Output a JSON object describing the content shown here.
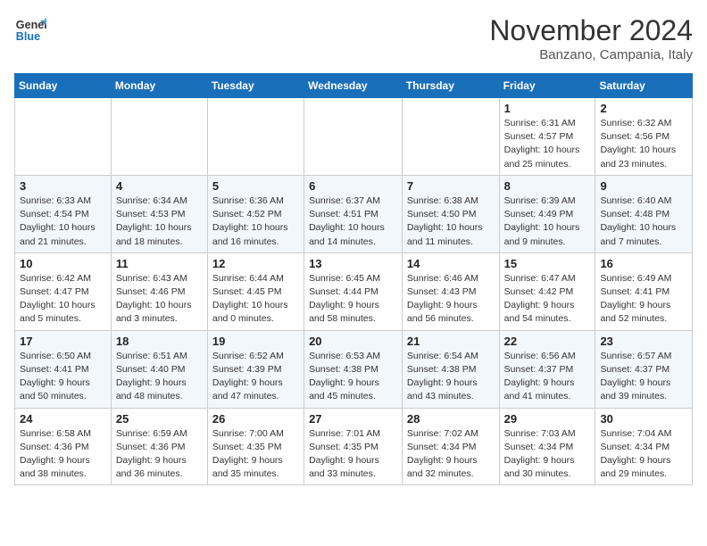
{
  "logo": {
    "line1": "General",
    "line2": "Blue"
  },
  "title": "November 2024",
  "location": "Banzano, Campania, Italy",
  "weekdays": [
    "Sunday",
    "Monday",
    "Tuesday",
    "Wednesday",
    "Thursday",
    "Friday",
    "Saturday"
  ],
  "weeks": [
    [
      {
        "day": "",
        "info": ""
      },
      {
        "day": "",
        "info": ""
      },
      {
        "day": "",
        "info": ""
      },
      {
        "day": "",
        "info": ""
      },
      {
        "day": "",
        "info": ""
      },
      {
        "day": "1",
        "info": "Sunrise: 6:31 AM\nSunset: 4:57 PM\nDaylight: 10 hours and 25 minutes."
      },
      {
        "day": "2",
        "info": "Sunrise: 6:32 AM\nSunset: 4:56 PM\nDaylight: 10 hours and 23 minutes."
      }
    ],
    [
      {
        "day": "3",
        "info": "Sunrise: 6:33 AM\nSunset: 4:54 PM\nDaylight: 10 hours and 21 minutes."
      },
      {
        "day": "4",
        "info": "Sunrise: 6:34 AM\nSunset: 4:53 PM\nDaylight: 10 hours and 18 minutes."
      },
      {
        "day": "5",
        "info": "Sunrise: 6:36 AM\nSunset: 4:52 PM\nDaylight: 10 hours and 16 minutes."
      },
      {
        "day": "6",
        "info": "Sunrise: 6:37 AM\nSunset: 4:51 PM\nDaylight: 10 hours and 14 minutes."
      },
      {
        "day": "7",
        "info": "Sunrise: 6:38 AM\nSunset: 4:50 PM\nDaylight: 10 hours and 11 minutes."
      },
      {
        "day": "8",
        "info": "Sunrise: 6:39 AM\nSunset: 4:49 PM\nDaylight: 10 hours and 9 minutes."
      },
      {
        "day": "9",
        "info": "Sunrise: 6:40 AM\nSunset: 4:48 PM\nDaylight: 10 hours and 7 minutes."
      }
    ],
    [
      {
        "day": "10",
        "info": "Sunrise: 6:42 AM\nSunset: 4:47 PM\nDaylight: 10 hours and 5 minutes."
      },
      {
        "day": "11",
        "info": "Sunrise: 6:43 AM\nSunset: 4:46 PM\nDaylight: 10 hours and 3 minutes."
      },
      {
        "day": "12",
        "info": "Sunrise: 6:44 AM\nSunset: 4:45 PM\nDaylight: 10 hours and 0 minutes."
      },
      {
        "day": "13",
        "info": "Sunrise: 6:45 AM\nSunset: 4:44 PM\nDaylight: 9 hours and 58 minutes."
      },
      {
        "day": "14",
        "info": "Sunrise: 6:46 AM\nSunset: 4:43 PM\nDaylight: 9 hours and 56 minutes."
      },
      {
        "day": "15",
        "info": "Sunrise: 6:47 AM\nSunset: 4:42 PM\nDaylight: 9 hours and 54 minutes."
      },
      {
        "day": "16",
        "info": "Sunrise: 6:49 AM\nSunset: 4:41 PM\nDaylight: 9 hours and 52 minutes."
      }
    ],
    [
      {
        "day": "17",
        "info": "Sunrise: 6:50 AM\nSunset: 4:41 PM\nDaylight: 9 hours and 50 minutes."
      },
      {
        "day": "18",
        "info": "Sunrise: 6:51 AM\nSunset: 4:40 PM\nDaylight: 9 hours and 48 minutes."
      },
      {
        "day": "19",
        "info": "Sunrise: 6:52 AM\nSunset: 4:39 PM\nDaylight: 9 hours and 47 minutes."
      },
      {
        "day": "20",
        "info": "Sunrise: 6:53 AM\nSunset: 4:38 PM\nDaylight: 9 hours and 45 minutes."
      },
      {
        "day": "21",
        "info": "Sunrise: 6:54 AM\nSunset: 4:38 PM\nDaylight: 9 hours and 43 minutes."
      },
      {
        "day": "22",
        "info": "Sunrise: 6:56 AM\nSunset: 4:37 PM\nDaylight: 9 hours and 41 minutes."
      },
      {
        "day": "23",
        "info": "Sunrise: 6:57 AM\nSunset: 4:37 PM\nDaylight: 9 hours and 39 minutes."
      }
    ],
    [
      {
        "day": "24",
        "info": "Sunrise: 6:58 AM\nSunset: 4:36 PM\nDaylight: 9 hours and 38 minutes."
      },
      {
        "day": "25",
        "info": "Sunrise: 6:59 AM\nSunset: 4:36 PM\nDaylight: 9 hours and 36 minutes."
      },
      {
        "day": "26",
        "info": "Sunrise: 7:00 AM\nSunset: 4:35 PM\nDaylight: 9 hours and 35 minutes."
      },
      {
        "day": "27",
        "info": "Sunrise: 7:01 AM\nSunset: 4:35 PM\nDaylight: 9 hours and 33 minutes."
      },
      {
        "day": "28",
        "info": "Sunrise: 7:02 AM\nSunset: 4:34 PM\nDaylight: 9 hours and 32 minutes."
      },
      {
        "day": "29",
        "info": "Sunrise: 7:03 AM\nSunset: 4:34 PM\nDaylight: 9 hours and 30 minutes."
      },
      {
        "day": "30",
        "info": "Sunrise: 7:04 AM\nSunset: 4:34 PM\nDaylight: 9 hours and 29 minutes."
      }
    ]
  ]
}
